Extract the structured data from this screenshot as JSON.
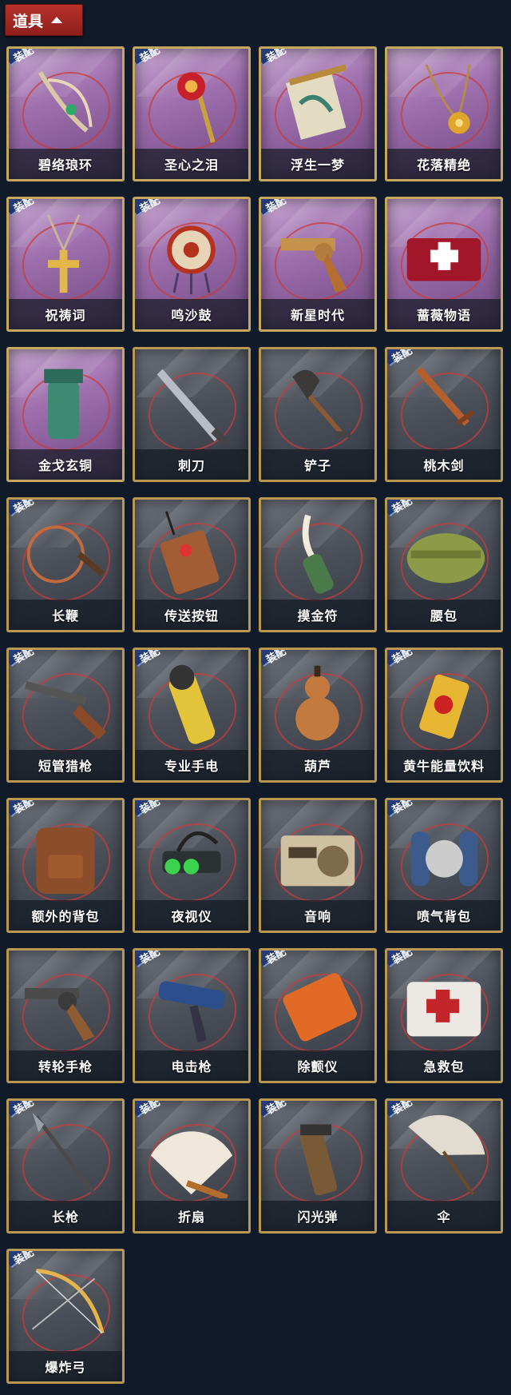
{
  "header": {
    "label": "道具"
  },
  "equip_tag": "装配",
  "items": [
    {
      "name": "碧络琅环",
      "rare": true,
      "equip": true,
      "icon": "jade-ring-icon"
    },
    {
      "name": "圣心之泪",
      "rare": true,
      "equip": true,
      "icon": "heart-scepter-icon"
    },
    {
      "name": "浮生一梦",
      "rare": true,
      "equip": true,
      "icon": "scroll-icon"
    },
    {
      "name": "花落精绝",
      "rare": true,
      "equip": false,
      "icon": "flower-necklace-icon"
    },
    {
      "name": "祝祷词",
      "rare": true,
      "equip": true,
      "icon": "cross-necklace-icon"
    },
    {
      "name": "鸣沙鼓",
      "rare": true,
      "equip": true,
      "icon": "sand-drum-icon"
    },
    {
      "name": "新星时代",
      "rare": true,
      "equip": true,
      "icon": "golden-revolver-icon"
    },
    {
      "name": "蔷薇物语",
      "rare": true,
      "equip": false,
      "icon": "first-aid-case-icon"
    },
    {
      "name": "金戈玄铜",
      "rare": true,
      "equip": false,
      "icon": "bronze-grenade-icon"
    },
    {
      "name": "刺刀",
      "rare": false,
      "equip": false,
      "icon": "bayonet-icon"
    },
    {
      "name": "铲子",
      "rare": false,
      "equip": false,
      "icon": "shovel-icon"
    },
    {
      "name": "桃木剑",
      "rare": false,
      "equip": true,
      "icon": "wooden-sword-icon"
    },
    {
      "name": "长鞭",
      "rare": false,
      "equip": true,
      "icon": "whip-icon"
    },
    {
      "name": "传送按钮",
      "rare": false,
      "equip": false,
      "icon": "teleport-button-icon"
    },
    {
      "name": "摸金符",
      "rare": false,
      "equip": false,
      "icon": "talisman-tooth-icon"
    },
    {
      "name": "腰包",
      "rare": false,
      "equip": true,
      "icon": "waist-bag-icon"
    },
    {
      "name": "短管猎枪",
      "rare": false,
      "equip": true,
      "icon": "shotgun-icon"
    },
    {
      "name": "专业手电",
      "rare": false,
      "equip": true,
      "icon": "flashlight-icon"
    },
    {
      "name": "葫芦",
      "rare": false,
      "equip": true,
      "icon": "gourd-icon"
    },
    {
      "name": "黄牛能量饮料",
      "rare": false,
      "equip": true,
      "icon": "energy-drink-icon"
    },
    {
      "name": "额外的背包",
      "rare": false,
      "equip": true,
      "icon": "backpack-icon"
    },
    {
      "name": "夜视仪",
      "rare": false,
      "equip": true,
      "icon": "night-vision-icon"
    },
    {
      "name": "音响",
      "rare": false,
      "equip": false,
      "icon": "radio-icon"
    },
    {
      "name": "喷气背包",
      "rare": false,
      "equip": true,
      "icon": "jetpack-icon"
    },
    {
      "name": "转轮手枪",
      "rare": false,
      "equip": false,
      "icon": "revolver-icon"
    },
    {
      "name": "电击枪",
      "rare": false,
      "equip": true,
      "icon": "stun-gun-icon"
    },
    {
      "name": "除颤仪",
      "rare": false,
      "equip": true,
      "icon": "defibrillator-icon"
    },
    {
      "name": "急救包",
      "rare": false,
      "equip": true,
      "icon": "medkit-icon"
    },
    {
      "name": "长枪",
      "rare": false,
      "equip": true,
      "icon": "spear-icon"
    },
    {
      "name": "折扇",
      "rare": false,
      "equip": true,
      "icon": "folding-fan-icon"
    },
    {
      "name": "闪光弹",
      "rare": false,
      "equip": true,
      "icon": "flashbang-icon"
    },
    {
      "name": "伞",
      "rare": false,
      "equip": true,
      "icon": "umbrella-icon"
    },
    {
      "name": "爆炸弓",
      "rare": false,
      "equip": true,
      "icon": "explosive-bow-icon"
    }
  ]
}
